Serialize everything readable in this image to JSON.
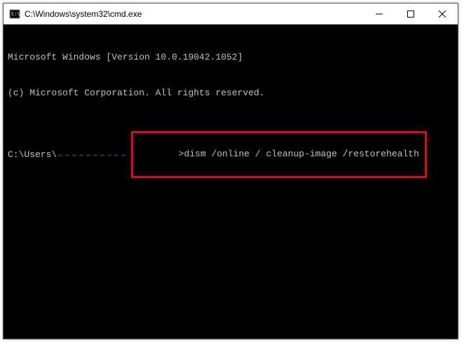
{
  "title_bar": {
    "path": "C:\\Windows\\system32\\cmd.exe"
  },
  "terminal": {
    "line1": "Microsoft Windows [Version 10.0.19042.1052]",
    "line2": "(c) Microsoft Corporation. All rights reserved.",
    "prompt_prefix": "C:\\Users\\",
    "command": ">dism /online / cleanup-image /restorehealth"
  },
  "highlight_color": "#e30613"
}
